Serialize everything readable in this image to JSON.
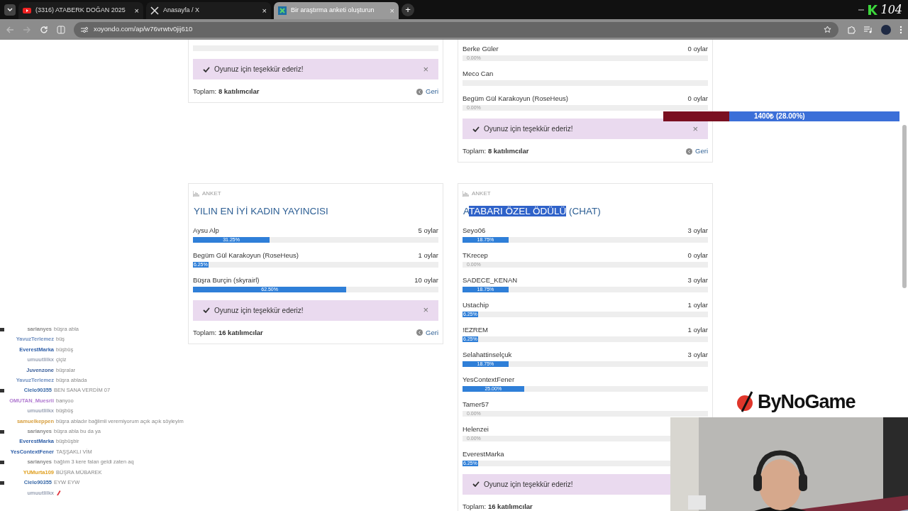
{
  "browser": {
    "tabs": [
      {
        "title": "(3316) ATABERK DOĞAN 2025",
        "close": "×",
        "selected": false
      },
      {
        "title": "Anasayfa / X",
        "close": "×",
        "selected": false
      },
      {
        "title": "Bir araştırma anketi oluşturun",
        "close": "×",
        "selected": true
      }
    ],
    "new_tab": "+",
    "url": "xoyondo.com/ap/w76vrwtv0jij610",
    "corner_badge": "104"
  },
  "rows": [
    {
      "polls": [
        {
          "options": [
            {
              "level": 0
            }
          ],
          "alert": "Oyunuz için teşekkür ederiz!",
          "close": "×",
          "total_label": "Toplam:",
          "total": "8 katılımcılar",
          "back": "Geri"
        },
        {
          "options": [
            {
              "name": "Berke Güler",
              "votes": "0 oylar",
              "level": 0,
              "percent": "0.00%"
            },
            {
              "name": "Meco Can",
              "level": 0
            },
            {
              "name": "Begüm Gül Karakoyun (RoseHeus)",
              "votes": "0 oylar",
              "level": 0,
              "percent": "0.00%"
            }
          ],
          "alert": "Oyunuz için teşekkür ederiz!",
          "close": "×",
          "total_label": "Toplam:",
          "total": "8 katılımcılar",
          "back": "Geri"
        }
      ]
    },
    {
      "polls": [
        {
          "label": "ANKET",
          "title": [
            {
              "text": "YILIN EN İYİ KADIN YAYINCISI",
              "highlighted": false
            }
          ],
          "options": [
            {
              "name": "Aysu Alp",
              "votes": "5 oylar",
              "level": 0.3125,
              "percent": "31.25%"
            },
            {
              "name": "Begüm Gül Karakoyun (RoseHeus)",
              "votes": "1 oylar",
              "level": 0.0625,
              "percent": "6.25%"
            },
            {
              "name": "Büşra Burçin (skyrairl)",
              "votes": "10 oylar",
              "level": 0.625,
              "percent": "62.50%"
            }
          ],
          "alert": "Oyunuz için teşekkür ederiz!",
          "close": "×",
          "total_label": "Toplam:",
          "total": "16 katılımcılar",
          "back": "Geri"
        },
        {
          "label": "ANKET",
          "title": [
            {
              "text": "A",
              "highlighted": false
            },
            {
              "text": "TABARI ÖZEL ÖDÜLÜ",
              "highlighted": true
            },
            {
              "text": " (CHAT)",
              "highlighted": false
            }
          ],
          "options": [
            {
              "name": "Seyo06",
              "votes": "3 oylar",
              "level": 0.1875,
              "percent": "18.75%"
            },
            {
              "name": "TKrecep",
              "votes": "0 oylar",
              "level": 0,
              "percent": "0.00%"
            },
            {
              "name": "SADECE_KENAN",
              "votes": "3 oylar",
              "level": 0.1875,
              "percent": "18.75%"
            },
            {
              "name": "Ustachip",
              "votes": "1 oylar",
              "level": 0.0625,
              "percent": "6.25%"
            },
            {
              "name": "!EZREM",
              "votes": "1 oylar",
              "level": 0.0625,
              "percent": "6.25%"
            },
            {
              "name": "Selahattinselçuk",
              "votes": "3 oylar",
              "level": 0.1875,
              "percent": "18.75%"
            },
            {
              "name": "YesContextFener",
              "level": 0.25,
              "percent": "25.00%"
            },
            {
              "name": "Tamer57",
              "level": 0,
              "percent": "0.00%"
            },
            {
              "name": "Helenzei",
              "level": 0,
              "percent": "0.00%"
            },
            {
              "name": "EverestMarka",
              "level": 0.0625,
              "percent": "6.25%"
            }
          ],
          "alert": "Oyunuz için teşekkür ederiz!",
          "total_label": "Toplam:",
          "total": "16 katılımcılar"
        }
      ]
    }
  ],
  "donation_bar": {
    "text": "1400₺ (28.00%)",
    "level": 0.28
  },
  "sponsor": "ByNoGame",
  "chat": [
    {
      "user": "sarianyes",
      "color": "#8a8a8a",
      "badge": true,
      "message": "büşra abla"
    },
    {
      "user": "YavuzTerlemez",
      "color": "#6f8fc0",
      "badge": false,
      "message": "büş"
    },
    {
      "user": "EverestMarka",
      "color": "#2f5fa8",
      "badge": false,
      "message": "büşbüş"
    },
    {
      "user": "umuutlilkx",
      "color": "#9aa3b5",
      "badge": false,
      "message": "çiçiz"
    },
    {
      "user": "Juvenzone",
      "color": "#3a5f9a",
      "badge": false,
      "message": "büşralar"
    },
    {
      "user": "YavuzTerlemez",
      "color": "#6f8fc0",
      "badge": false,
      "message": "büşra ablada"
    },
    {
      "user": "Cielo90355",
      "color": "#3a6aa8",
      "badge": true,
      "message": "BEN SANA VERDİM 07"
    },
    {
      "user": "OMUTAN_Muesrii",
      "color": "#b07ad0",
      "badge": false,
      "message": "banyoo"
    },
    {
      "user": "umuutlilkx",
      "color": "#9aa3b5",
      "badge": false,
      "message": "büşbüş"
    },
    {
      "user": "samuelkeppen",
      "color": "#d8a040",
      "badge": false,
      "message": "büşra abladır bağlimli veremiyorum açık açık söyleyim"
    },
    {
      "user": "sarianyes",
      "color": "#8a8a8a",
      "badge": true,
      "message": "büşra abla bu da ya"
    },
    {
      "user": "EverestMarka",
      "color": "#2f5fa8",
      "badge": false,
      "message": "büşbüşbir"
    },
    {
      "user": "YesContextFener",
      "color": "#2f5fa8",
      "badge": false,
      "message": "TAŞŞAKLI VİM"
    },
    {
      "user": "sarianyes",
      "color": "#8a8a8a",
      "badge": true,
      "message": "bağlım 3 kere falan geldi zaten aq"
    },
    {
      "user": "YUMurta109",
      "color": "#e0a020",
      "badge": false,
      "message": "BÜŞRA MÜBAREK"
    },
    {
      "user": "Cielo90355",
      "color": "#3a6aa8",
      "badge": true,
      "message": "EYW EYW"
    },
    {
      "user": "umuutlilkx",
      "color": "#9aa3b5",
      "badge": false,
      "kind": "emote"
    }
  ]
}
